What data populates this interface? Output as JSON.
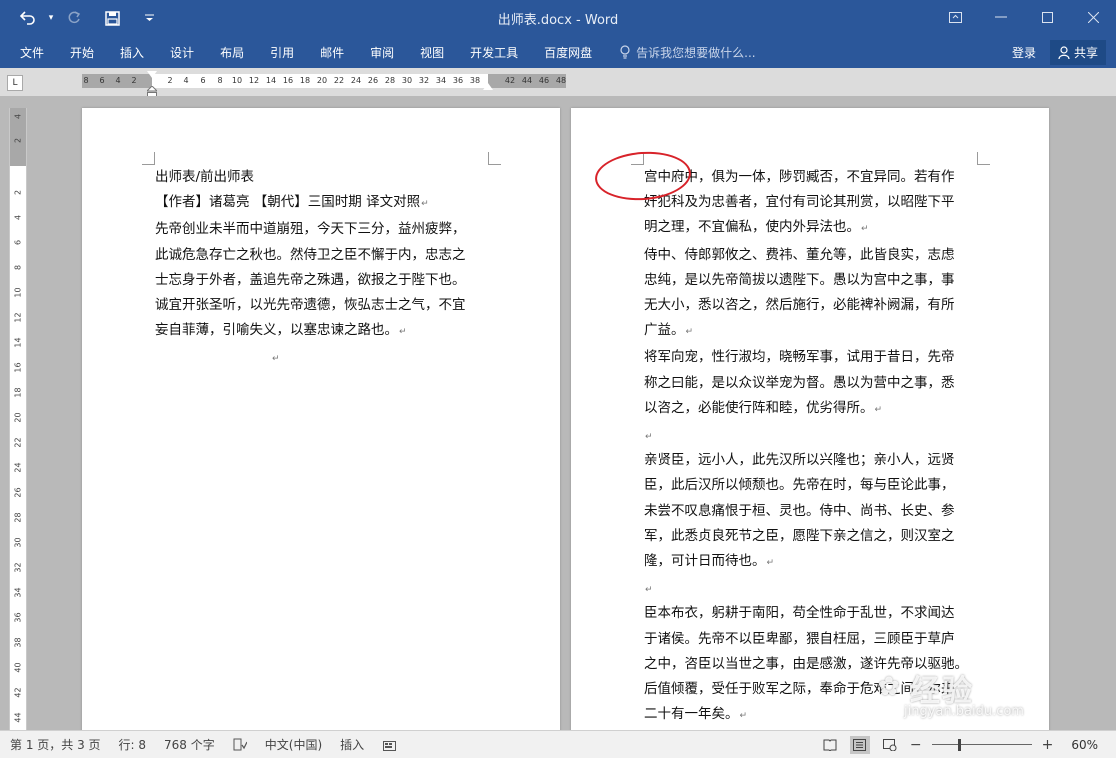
{
  "window": {
    "title": "出师表.docx - Word",
    "qat": {
      "undo_icon": "undo-icon",
      "redo_icon": "redo-icon",
      "save_icon": "save-icon",
      "customize_icon": "chevron-down-icon"
    },
    "controls": [
      "restore-ribbon-icon",
      "minimize-icon",
      "maximize-icon",
      "close-icon"
    ]
  },
  "ribbon": {
    "tabs": [
      "文件",
      "开始",
      "插入",
      "设计",
      "布局",
      "引用",
      "邮件",
      "审阅",
      "视图",
      "开发工具",
      "百度网盘"
    ],
    "tell_me": "告诉我您想要做什么...",
    "login": "登录",
    "share": "共享"
  },
  "ruler": {
    "tab_selector": "L",
    "numbers": [
      "8",
      "6",
      "4",
      "2",
      "2",
      "4",
      "6",
      "8",
      "10",
      "12",
      "14",
      "16",
      "18",
      "20",
      "22",
      "24",
      "26",
      "28",
      "30",
      "32",
      "34",
      "36",
      "38",
      "42",
      "44",
      "46",
      "48"
    ],
    "vertical_numbers": [
      "4",
      "2",
      "2",
      "4",
      "6",
      "8",
      "10",
      "12",
      "14",
      "16",
      "18",
      "20",
      "22",
      "24",
      "26",
      "28",
      "30",
      "32",
      "34",
      "36",
      "38",
      "40",
      "42",
      "44"
    ]
  },
  "document": {
    "page1": [
      "出师表/前出师表",
      "【作者】诸葛亮 【朝代】三国时期 译文对照",
      "先帝创业未半而中道崩殂，今天下三分，益州疲弊，",
      "此诚危急存亡之秋也。然侍卫之臣不懈于内，忠志之",
      "士忘身于外者，盖追先帝之殊遇，欲报之于陛下也。",
      "诚宜开张圣听，以光先帝遗德，恢弘志士之气，不宜",
      "妄自菲薄，引喻失义，以塞忠谏之路也。",
      ""
    ],
    "page2": [
      "宫中府中，俱为一体，陟罚臧否，不宜异同。若有作",
      "奸犯科及为忠善者，宜付有司论其刑赏，以昭陛下平",
      "明之理，不宜偏私，使内外异法也。",
      "侍中、侍郎郭攸之、费祎、董允等，此皆良实，志虑",
      "忠纯，是以先帝简拔以遗陛下。愚以为宫中之事，事",
      "无大小，悉以咨之，然后施行，必能裨补阙漏，有所",
      "广益。",
      "将军向宠，性行淑均，晓畅军事，试用于昔日，先帝",
      "称之曰能，是以众议举宠为督。愚以为营中之事，悉",
      "以咨之，必能使行阵和睦，优劣得所。",
      "",
      "亲贤臣，远小人，此先汉所以兴隆也；亲小人，远贤",
      "臣，此后汉所以倾颓也。先帝在时，每与臣论此事，",
      "未尝不叹息痛恨于桓、灵也。侍中、尚书、长史、参",
      "军，此悉贞良死节之臣，愿陛下亲之信之，则汉室之",
      "隆，可计日而待也。",
      "",
      "臣本布衣，躬耕于南阳，苟全性命于乱世，不求闻达",
      "于诸侯。先帝不以臣卑鄙，猥自枉屈，三顾臣于草庐",
      "之中，咨臣以当世之事，由是感激，遂许先帝以驱驰。",
      "后值倾覆，受任于败军之际，奉命于危难之间，尔来",
      "二十有一年矣。"
    ],
    "paragraph_mark": "↵"
  },
  "watermark": {
    "main": "经验",
    "sub": "jingyan.baidu.com"
  },
  "statusbar": {
    "page": "第 1 页，共 3 页",
    "line": "行: 8",
    "words": "768 个字",
    "language": "中文(中国)",
    "mode": "插入",
    "zoom": "60%",
    "zoom_level": 0.6
  },
  "colors": {
    "ribbon": "#2b579a",
    "annotation": "#d8232a"
  }
}
